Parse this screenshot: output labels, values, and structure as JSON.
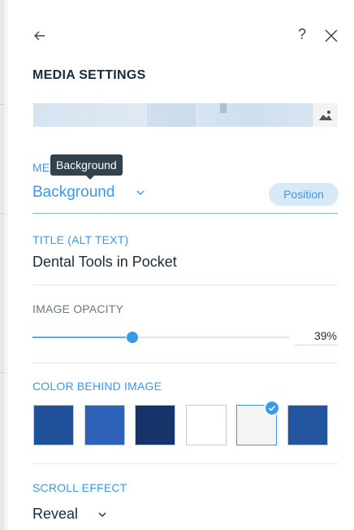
{
  "header": {
    "title": "MEDIA SETTINGS",
    "back_icon": "arrow-left-icon",
    "help_label": "?",
    "close_icon": "close-icon"
  },
  "media_preview": {
    "icon": "image-icon"
  },
  "media_type": {
    "label_fragment": "ME",
    "tooltip": "Background",
    "value": "Background",
    "position_label": "Position"
  },
  "title_field": {
    "label": "TITLE (ALT TEXT)",
    "value": "Dental Tools in Pocket"
  },
  "opacity": {
    "label": "IMAGE OPACITY",
    "value_percent": 39,
    "display": "39%"
  },
  "color_behind": {
    "label": "COLOR BEHIND IMAGE",
    "swatches": [
      {
        "color": "#20529b",
        "selected": false
      },
      {
        "color": "#2d62b8",
        "selected": false
      },
      {
        "color": "#17346a",
        "selected": false
      },
      {
        "color": "#ffffff",
        "selected": false
      },
      {
        "color": "#f4f4f4",
        "selected": true
      },
      {
        "color": "#23549f",
        "selected": false
      }
    ]
  },
  "scroll_effect": {
    "label": "SCROLL EFFECT",
    "value": "Reveal"
  },
  "colors": {
    "accent": "#3899ec",
    "text": "#162d3d"
  }
}
